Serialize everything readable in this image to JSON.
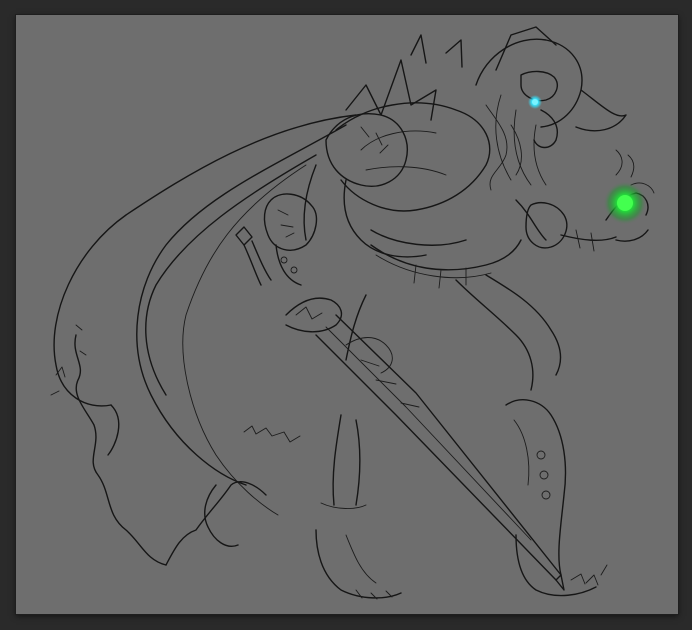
{
  "document": {
    "background_color": "#6e6e6e",
    "workspace_color": "#2a2a2a"
  },
  "artwork": {
    "subject": "warrior-with-sword-lineart",
    "line_color": "#161616",
    "orb_glow_color": "#22e03a",
    "eye_glow_color": "#34e4ff"
  }
}
